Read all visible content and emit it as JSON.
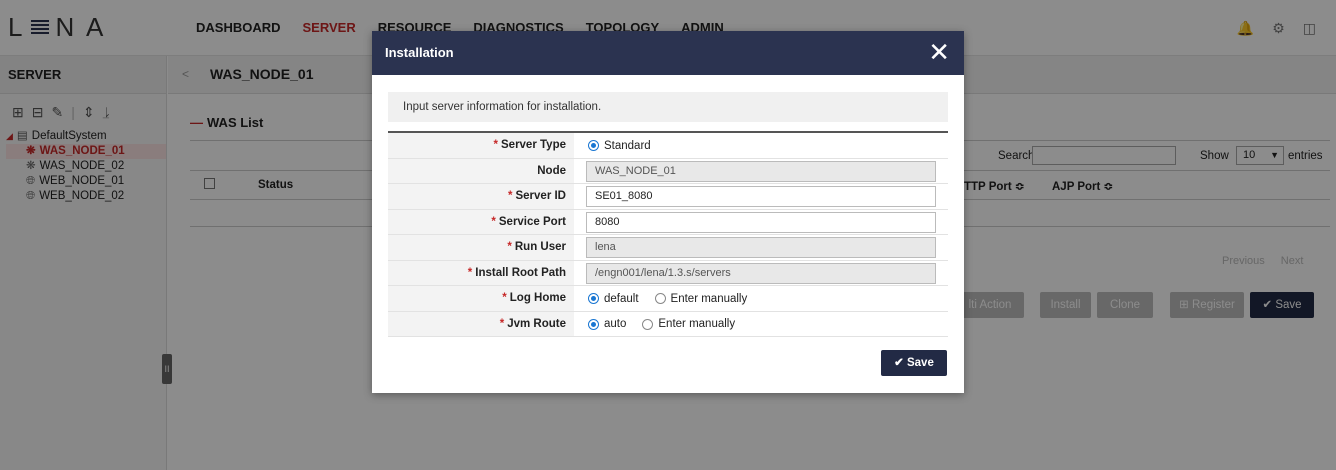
{
  "app": {
    "logo_left": "L",
    "logo_right": "N A",
    "nav": [
      "DASHBOARD",
      "SERVER",
      "RESOURCE",
      "DIAGNOSTICS",
      "TOPOLOGY",
      "ADMIN"
    ],
    "active_nav": "SERVER"
  },
  "sidebar": {
    "title": "SERVER",
    "tree": {
      "root": "DefaultSystem",
      "items": [
        "WAS_NODE_01",
        "WAS_NODE_02",
        "WEB_NODE_01",
        "WEB_NODE_02"
      ],
      "selected": "WAS_NODE_01"
    },
    "collapse_glyph": "II"
  },
  "main": {
    "breadcrumb": "WAS_NODE_01",
    "breadcrumb_arrow": "<",
    "section_title": "WAS List",
    "search_label": "Search",
    "search_value": "",
    "show_label": "Show",
    "show_value": "10",
    "entries_label": "entries",
    "columns": {
      "status": "Status",
      "http_port": "TTP Port ≎",
      "ajp_port": "AJP Port ≎"
    },
    "pager": {
      "previous": "Previous",
      "next": "Next"
    },
    "buttons": {
      "multi_action": "lti Action",
      "install": "Install",
      "clone": "Clone",
      "register": "Register",
      "save": "Save"
    }
  },
  "modal": {
    "title": "Installation",
    "close_glyph": "✕",
    "notice": "Input server information for installation.",
    "fields": {
      "server_type": {
        "label": "Server Type",
        "required": true,
        "option": "Standard"
      },
      "node": {
        "label": "Node",
        "required": false,
        "value": "WAS_NODE_01"
      },
      "server_id": {
        "label": "Server ID",
        "required": true,
        "value": "SE01_8080"
      },
      "service_port": {
        "label": "Service Port",
        "required": true,
        "value": "8080"
      },
      "run_user": {
        "label": "Run User",
        "required": true,
        "value": "lena"
      },
      "install_root": {
        "label": "Install Root Path",
        "required": true,
        "value": "/engn001/lena/1.3.s/servers"
      },
      "log_home": {
        "label": "Log Home",
        "required": true,
        "opt1": "default",
        "opt2": "Enter manually"
      },
      "jvm_route": {
        "label": "Jvm Route",
        "required": true,
        "opt1": "auto",
        "opt2": "Enter manually"
      }
    },
    "required_mark": "*",
    "save_label": "Save"
  },
  "colors": {
    "navy": "#2b3350",
    "accent_red": "#c62828",
    "radio_blue": "#1976d2"
  }
}
